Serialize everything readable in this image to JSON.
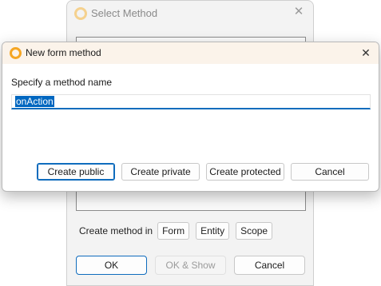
{
  "background_dialog": {
    "title": "Select Method",
    "close_glyph": "✕",
    "create_in_label": "Create method in",
    "create_in_options": [
      "Form",
      "Entity",
      "Scope"
    ],
    "ok_label": "OK",
    "ok_show_label": "OK & Show",
    "cancel_label": "Cancel"
  },
  "dialog": {
    "title": "New form method",
    "close_glyph": "✕",
    "prompt": "Specify a method name",
    "method_name_value": "onAction",
    "buttons": {
      "create_public": "Create public",
      "create_private": "Create private",
      "create_protected": "Create protected",
      "cancel": "Cancel"
    }
  },
  "icons": {
    "app_icon": "app-ring-icon",
    "close_icon": "close-icon"
  },
  "colors": {
    "accent": "#0f6cbd",
    "selection": "#0067c0",
    "app_icon": "#f5a623",
    "title_bar": "#fbf3ea"
  }
}
